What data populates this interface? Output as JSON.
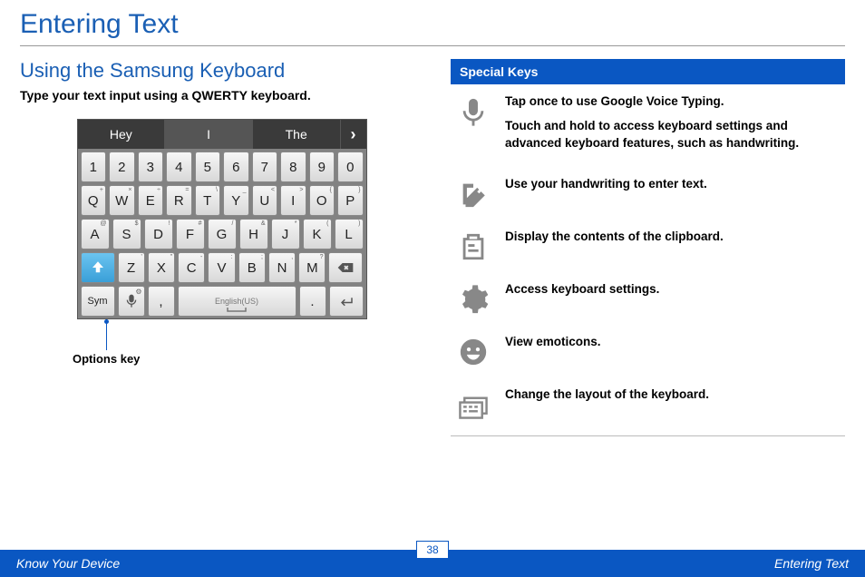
{
  "page_title": "Entering Text",
  "section_title": "Using the Samsung Keyboard",
  "intro": "Type your text input using a QWERTY keyboard.",
  "suggestions": [
    "Hey",
    "I",
    "The"
  ],
  "keyboard": {
    "row_numbers": [
      "1",
      "2",
      "3",
      "4",
      "5",
      "6",
      "7",
      "8",
      "9",
      "0"
    ],
    "row_q": [
      "Q",
      "W",
      "E",
      "R",
      "T",
      "Y",
      "U",
      "I",
      "O",
      "P"
    ],
    "row_a": [
      "A",
      "S",
      "D",
      "F",
      "G",
      "H",
      "J",
      "K",
      "L"
    ],
    "row_z": [
      "Z",
      "X",
      "C",
      "V",
      "B",
      "N",
      "M"
    ],
    "sym_label": "Sym",
    "space_label": "English(US)",
    "comma": ",",
    "period": "."
  },
  "callout_label": "Options key",
  "special_keys_header": "Special Keys",
  "special_keys": [
    {
      "icon": "microphone-icon",
      "desc1": "Tap once to use Google Voice Typing.",
      "desc2": "Touch and hold to access keyboard settings and advanced keyboard features, such as handwriting."
    },
    {
      "icon": "handwriting-icon",
      "desc1": "Use your handwriting to enter text."
    },
    {
      "icon": "clipboard-icon",
      "desc1": "Display the contents of the clipboard."
    },
    {
      "icon": "gear-icon",
      "desc1": "Access keyboard settings."
    },
    {
      "icon": "emoticon-icon",
      "desc1": "View emoticons."
    },
    {
      "icon": "keyboard-layout-icon",
      "desc1": "Change the layout of the keyboard."
    }
  ],
  "footer": {
    "left": "Know Your Device",
    "page": "38",
    "right": "Entering Text"
  }
}
